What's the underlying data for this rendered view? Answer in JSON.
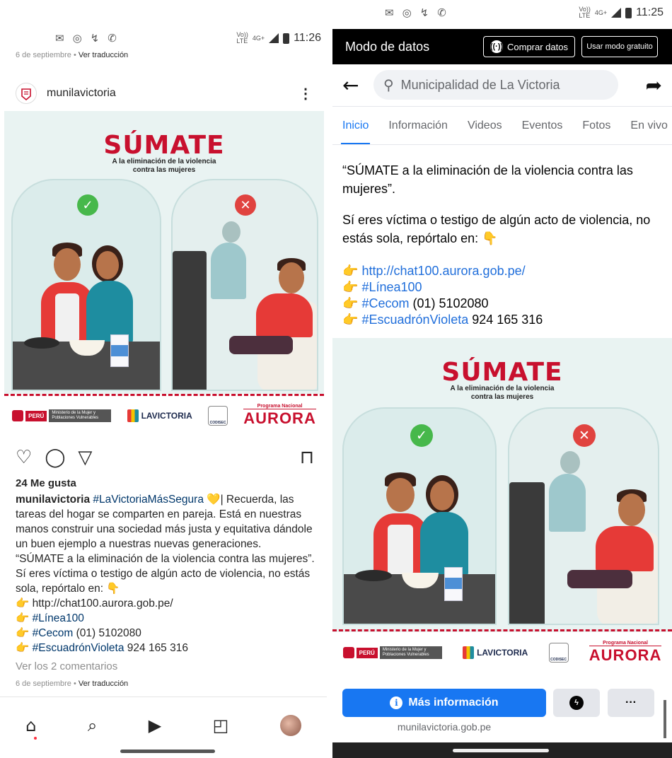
{
  "left": {
    "status": {
      "icons": [
        "✉",
        "◎",
        "↯",
        "✆"
      ],
      "net_top": "Vo))",
      "net_bottom": "LTE",
      "net": "4G+",
      "time": "11:26"
    },
    "date_top": {
      "date": "6 de septiembre",
      "sep": " • ",
      "translate": "Ver traducción"
    },
    "username": "munilavictoria",
    "more": "⋮",
    "image": {
      "title": "SÚMATE",
      "subtitle_1": "A la eliminación de la violencia",
      "subtitle_2": "contra las mujeres",
      "ok": "✓",
      "no": "✕",
      "peru": "PERÚ",
      "ministry": "Ministerio de la Mujer y Poblaciones Vulnerables",
      "lavictoria": "LAVICTORIA",
      "codisec": "CODISEC",
      "aurora_top": "Programa Nacional",
      "aurora": "AURORA"
    },
    "actions": {
      "like": "♡",
      "comment": "◯",
      "share": "▽",
      "save": "⊓"
    },
    "likes": "24 Me gusta",
    "caption": {
      "user": "munilavictoria",
      "tag": "#LaVictoriaMásSegura",
      "heart": "💛",
      "body": "| Recuerda, las tareas del hogar se comparten en pareja. Está en nuestras manos construir una sociedad más justa y equitativa dándole un buen ejemplo a nuestras nuevas generaciones.",
      "quote": " “SÚMATE a la eliminación de la violencia contra las mujeres”.",
      "report": "Sí eres víctima o testigo de algún acto de violencia, no estás sola, repórtalo en: 👇",
      "pointer": "👉",
      "line1": " http://chat100.aurora.gob.pe/",
      "line2_tag": "#Línea100",
      "line3_tag": "#Cecom",
      "line3_rest": " (01) 5102080",
      "line4_tag": "#EscuadrónVioleta",
      "line4_rest": " 924 165 316"
    },
    "comments": "Ver los 2 comentarios",
    "date_bottom": {
      "date": "6 de septiembre",
      "sep": " • ",
      "translate": "Ver traducción"
    },
    "nav": {
      "home": "⌂",
      "search": "⌕",
      "reels": "▶",
      "shop": "◰"
    }
  },
  "right": {
    "status": {
      "icons": [
        "✉",
        "◎",
        "↯",
        "✆"
      ],
      "net_top": "Vo))",
      "net_bottom": "LTE",
      "net": "4G+",
      "time": "11:25"
    },
    "data_mode": {
      "title": "Modo de datos",
      "buy": "Comprar datos",
      "free": "Usar modo gratuito",
      "wifi": "((·))"
    },
    "back": "←",
    "search_icon": "⚲",
    "search_text": "Municipalidad de La Victoria",
    "share": "➦",
    "tabs": [
      "Inicio",
      "Información",
      "Videos",
      "Eventos",
      "Fotos",
      "En vivo"
    ],
    "text": {
      "quote": " “SÚMATE a la eliminación de la violencia contra las mujeres”.",
      "report": "Sí eres víctima o testigo de algún acto de violencia, no estás sola, repórtalo en: 👇",
      "pointer": "👉",
      "link1": "http://chat100.aurora.gob.pe/",
      "tag2": "#Línea100",
      "tag3": "#Cecom",
      "rest3": " (01) 5102080",
      "tag4": "#EscuadrónVioleta",
      "rest4": " 924 165 316"
    },
    "image": {
      "title": "SÚMATE",
      "subtitle_1": "A la eliminación de la violencia",
      "subtitle_2": "contra las mujeres",
      "ok": "✓",
      "no": "✕",
      "peru": "PERÚ",
      "ministry": "Ministerio de la Mujer y Poblaciones Vulnerables",
      "lavictoria": "LAVICTORIA",
      "codisec": "CODISEC",
      "aurora_top": "Programa Nacional",
      "aurora": "AURORA"
    },
    "more_info": "Más información",
    "info_icon": "i",
    "messenger": "ϟ",
    "more": "···",
    "domain": "munilavictoria.gob.pe"
  },
  "colors": {
    "brand_red": "#c8102e",
    "fb_blue": "#1877f2",
    "ig_link": "#00376b"
  }
}
